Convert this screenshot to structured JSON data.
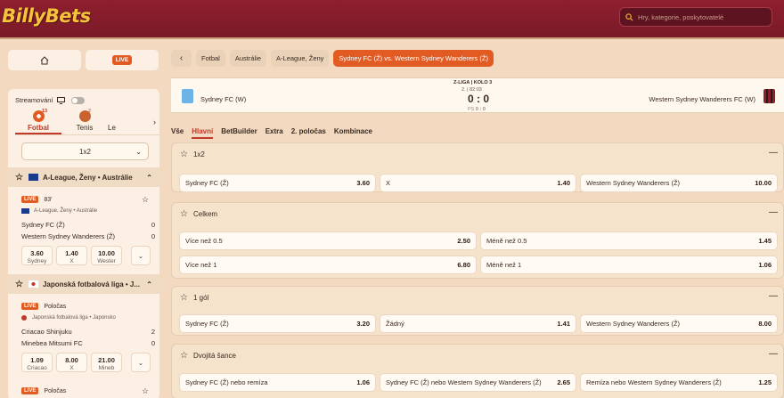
{
  "header": {
    "logo": "BillyBets",
    "search_placeholder": "Hry, kategorie, poskytovatelé"
  },
  "sidebar": {
    "live_label": "LIVE",
    "streaming_label": "Streamování",
    "sports": [
      {
        "label": "Fotbal",
        "count": "13"
      },
      {
        "label": "Tenis",
        "count": "2"
      },
      {
        "label": "Le"
      }
    ],
    "market_select": "1x2",
    "leagues": [
      {
        "title": "A-League, Ženy • Austrálie",
        "match": {
          "live": "LIVE",
          "time": "83'",
          "league": "A-League, Ženy • Austrálie",
          "home": "Sydney FC (Ž)",
          "home_score": "0",
          "away": "Western Sydney Wanderers (Ž)",
          "away_score": "0",
          "odds": [
            {
              "v": "3.60",
              "l": "Sydney"
            },
            {
              "v": "1.40",
              "l": "X"
            },
            {
              "v": "10.00",
              "l": "Wester"
            }
          ]
        }
      },
      {
        "title": "Japonská fotbalová liga • J...",
        "match": {
          "live": "LIVE",
          "time": "Poločas",
          "league": "Japonská fotbalová liga • Japonsko",
          "home": "Criacao Shinjuku",
          "home_score": "2",
          "away": "Minebea Mitsumi FC",
          "away_score": "0",
          "odds": [
            {
              "v": "1.09",
              "l": "Criacao"
            },
            {
              "v": "8.00",
              "l": "X"
            },
            {
              "v": "21.00",
              "l": "Mineb"
            }
          ]
        }
      },
      {
        "title": "",
        "match": {
          "live": "LIVE",
          "time": "Poločas"
        }
      }
    ]
  },
  "breadcrumb": [
    "Fotbal",
    "Austrálie",
    "A-League, Ženy",
    "Sydney FC (Ž) vs. Western Sydney Wanderers (Ž)"
  ],
  "match": {
    "league": "Z-LIGA | KOLO 3",
    "time": "2. | 82:03",
    "score": "0 : 0",
    "sub_label": "PS",
    "sub_score": "0 : 0",
    "home": "Sydney FC (W)",
    "away": "Western Sydney Wanderers FC (W)"
  },
  "tabs": [
    "Vše",
    "Hlavní",
    "BetBuilder",
    "Extra",
    "2. poločas",
    "Kombinace"
  ],
  "markets": [
    {
      "title": "1x2",
      "rows": [
        [
          {
            "l": "Sydney FC (Ž)",
            "v": "3.60"
          },
          {
            "l": "X",
            "v": "1.40"
          },
          {
            "l": "Western Sydney Wanderers (Ž)",
            "v": "10.00"
          }
        ]
      ]
    },
    {
      "title": "Celkem",
      "rows": [
        [
          {
            "l": "Více než 0.5",
            "v": "2.50"
          },
          {
            "l": "Méně než 0.5",
            "v": "1.45"
          }
        ],
        [
          {
            "l": "Více než 1",
            "v": "6.80"
          },
          {
            "l": "Méně než 1",
            "v": "1.06"
          }
        ]
      ]
    },
    {
      "title": "1 gól",
      "rows": [
        [
          {
            "l": "Sydney FC (Ž)",
            "v": "3.20"
          },
          {
            "l": "Žádný",
            "v": "1.41"
          },
          {
            "l": "Western Sydney Wanderers (Ž)",
            "v": "8.00"
          }
        ]
      ]
    },
    {
      "title": "Dvojitá šance",
      "rows": [
        [
          {
            "l": "Sydney FC (Ž) nebo remíza",
            "v": "1.06"
          },
          {
            "l": "Sydney FC (Ž) nebo Western Sydney Wanderers (Ž)",
            "v": "2.65"
          },
          {
            "l": "Remíza nebo Western Sydney Wanderers (Ž)",
            "v": "1.25"
          }
        ]
      ]
    }
  ],
  "colors": {
    "header": "#8e1f2e",
    "accent": "#e25b22",
    "active_tab": "#c0392b",
    "background": "#f2d9bf"
  }
}
